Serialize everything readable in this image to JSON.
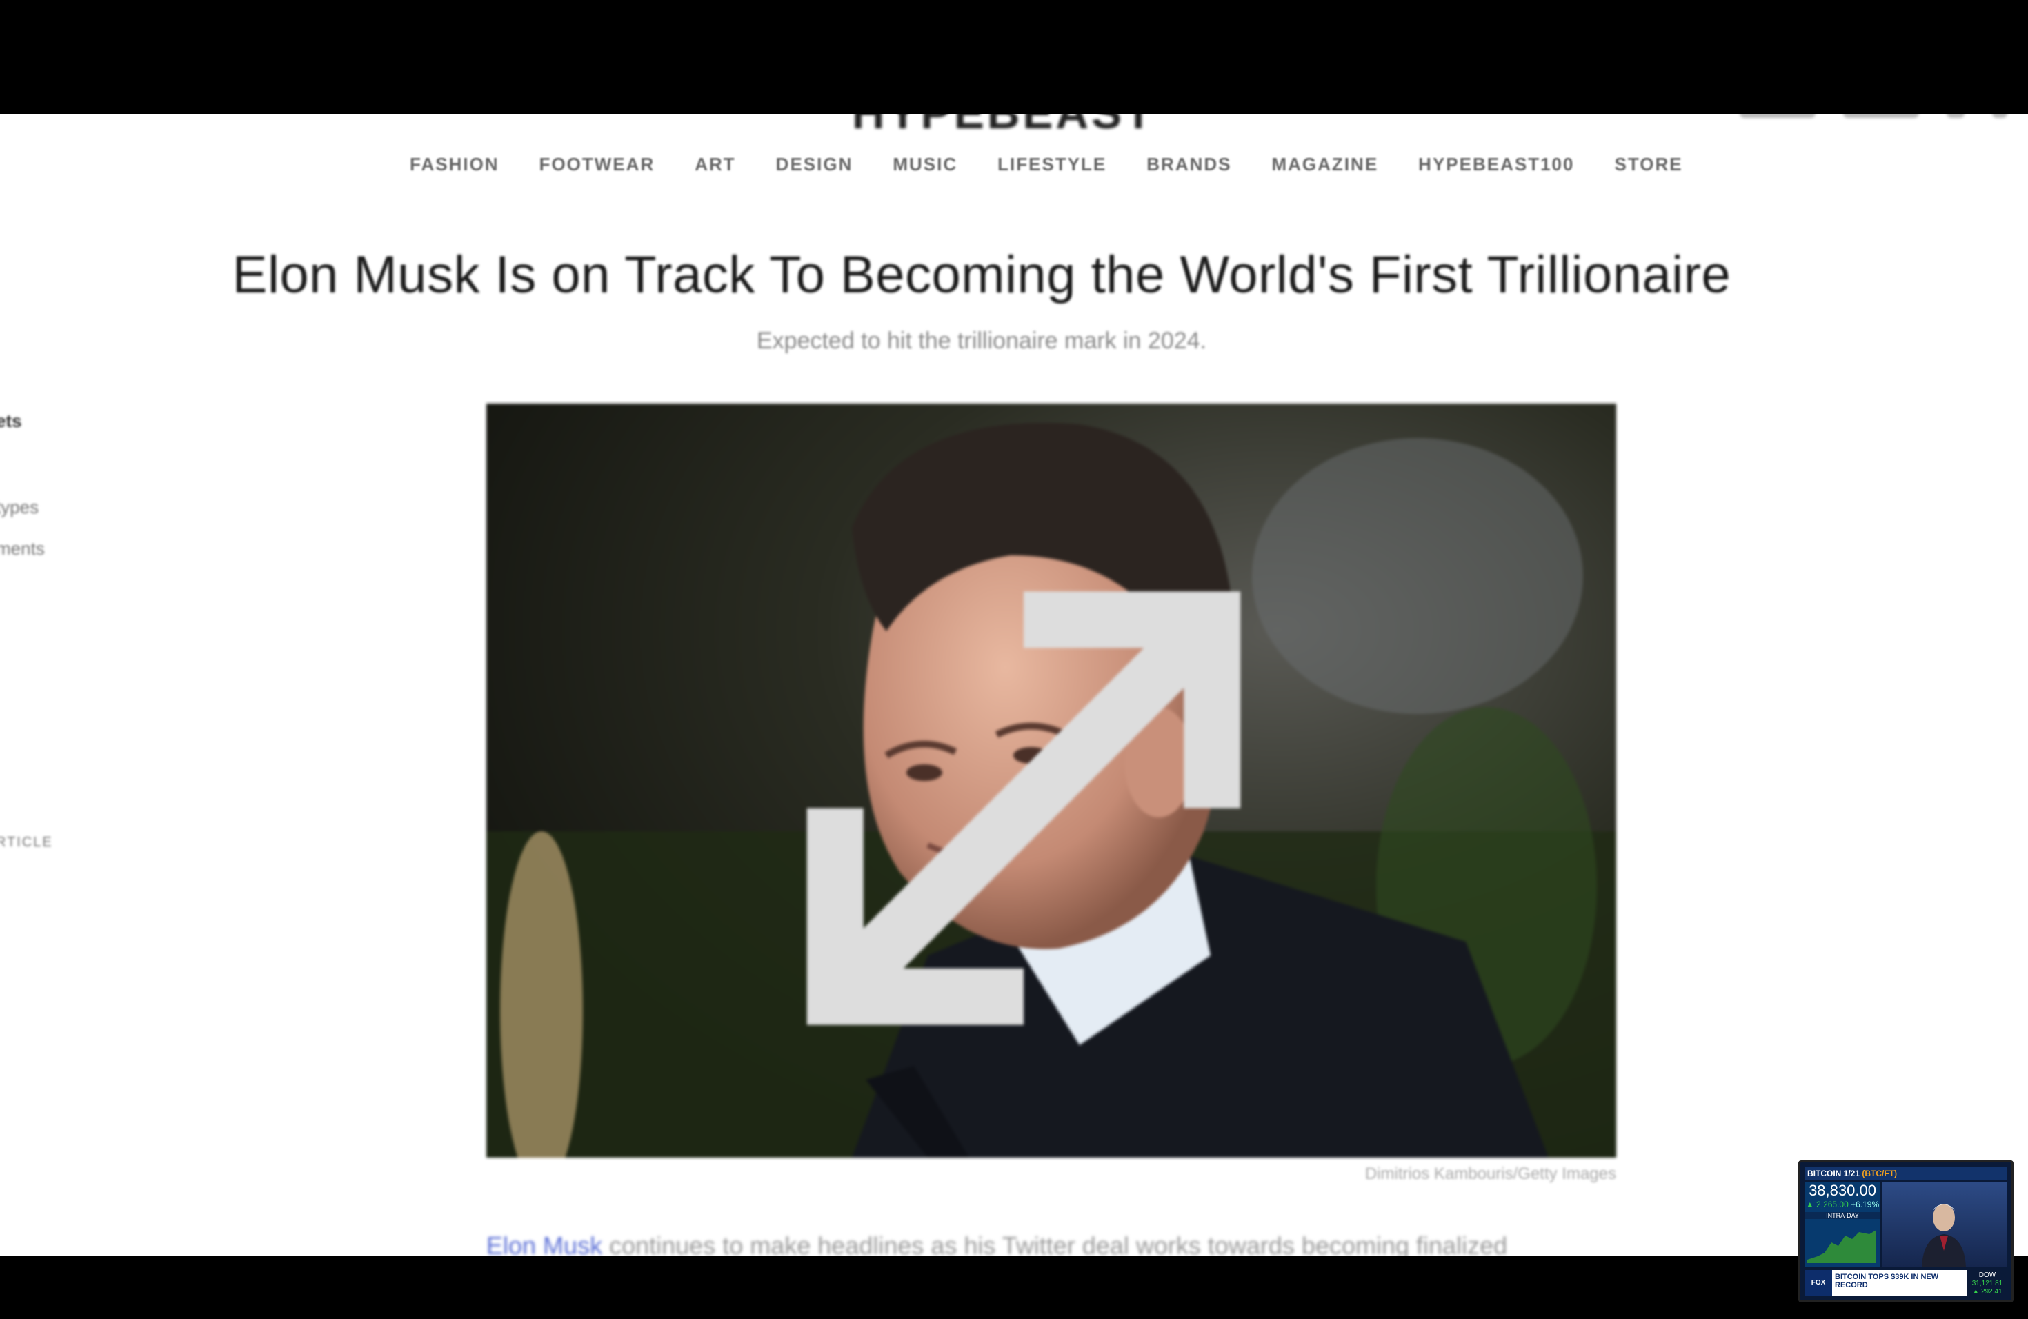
{
  "site": {
    "logo": "HYPEBEAST",
    "nav": [
      "FASHION",
      "FOOTWEAR",
      "ART",
      "DESIGN",
      "MUSIC",
      "LIFESTYLE",
      "BRANDS",
      "MAGAZINE",
      "HYPEBEAST100",
      "STORE"
    ]
  },
  "article": {
    "headline": "Elon Musk Is on Track To Becoming the World's First Trillionaire",
    "subtitle": "Expected to hit the trillionaire mark in 2024.",
    "image_credit": "Dimitrios Kambouris/Getty Images",
    "body_link": "Elon Musk",
    "body_text": "continues to make headlines as his Twitter deal works towards becoming finalized"
  },
  "side_rail": [
    "ets",
    "types",
    "ments",
    "RTICLE"
  ],
  "pip": {
    "header_left": "BITCOIN 1/21",
    "header_ticker": "(BTC/FT)",
    "price": "38,830.00",
    "change": "▲ 2,265.00",
    "change_pct": "+6.19%",
    "intra_label": "INTRA-DAY",
    "network": "FOX",
    "headline": "BITCOIN TOPS $39K IN NEW RECORD",
    "dow_label": "DOW",
    "dow_value": "31,121.81",
    "dow_change": "▲ 292.41"
  },
  "colors": {
    "accent_link": "#5b6fd6",
    "headline": "#1a1a1a",
    "pip_green": "#35d04b"
  }
}
